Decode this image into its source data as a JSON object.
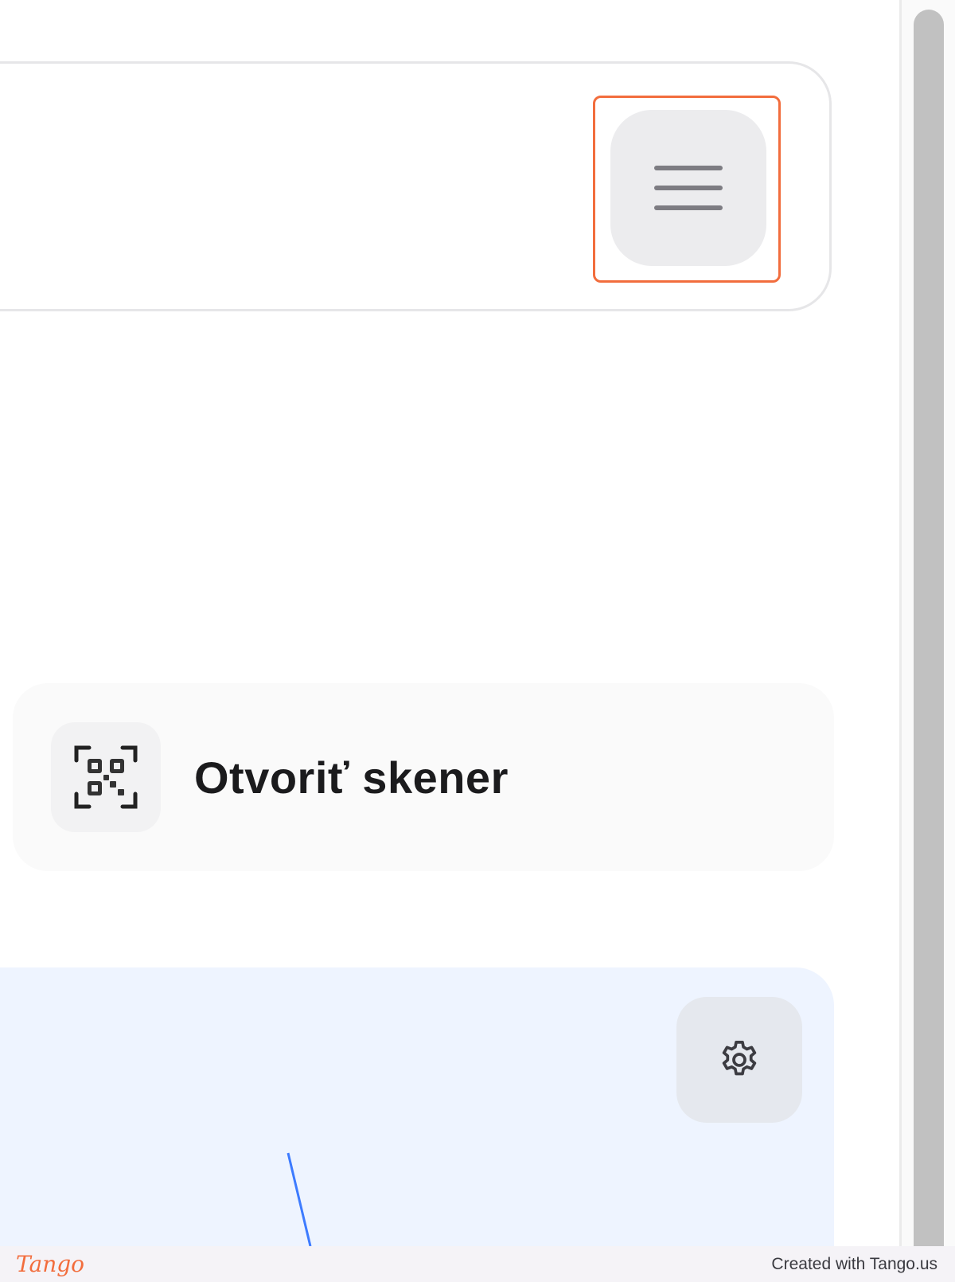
{
  "header": {
    "menu_button": {
      "icon": "hamburger-menu-icon",
      "highlighted": true
    }
  },
  "scanner": {
    "label": "Otvoriť skener",
    "icon": "qr-scan-icon"
  },
  "panel": {
    "settings_icon": "gear-icon"
  },
  "footer": {
    "logo": "Tango",
    "credit": "Created with Tango.us"
  },
  "colors": {
    "highlight": "#f26d3d",
    "panel_bg": "#eef4ff",
    "route_line": "#3d7bff",
    "text": "#1b1b1d"
  }
}
